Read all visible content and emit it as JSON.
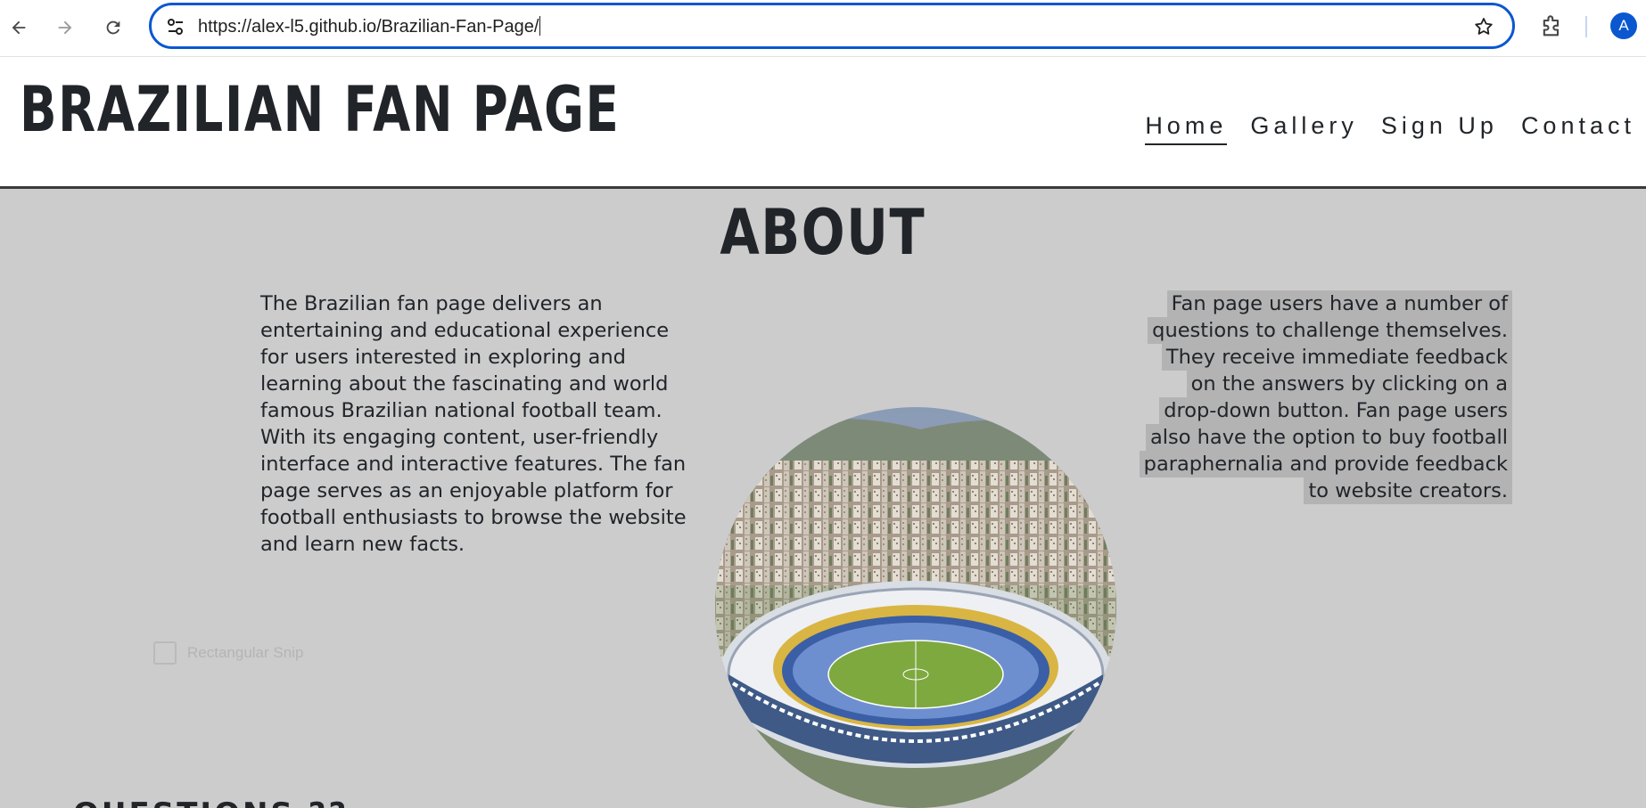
{
  "browser": {
    "url": "https://alex-l5.github.io/Brazilian-Fan-Page/",
    "avatar_letter": "A",
    "accent_color": "#0b57d0"
  },
  "header": {
    "title": "BRAZILIAN FAN PAGE",
    "nav": [
      {
        "label": "Home",
        "active": true
      },
      {
        "label": "Gallery",
        "active": false
      },
      {
        "label": "Sign Up",
        "active": false
      },
      {
        "label": "Contact",
        "active": false
      }
    ]
  },
  "about": {
    "heading": "ABOUT",
    "left_text": "The Brazilian fan page delivers an entertaining and educational experience for users interested in exploring and learning about the fascinating and world famous Brazilian national football team. With its engaging content, user-friendly interface and interactive features. The fan page serves as an enjoyable platform for football enthusiasts to browse the website and learn new facts.",
    "right_text": "Fan page users have a number of questions to challenge themselves. They receive immediate feedback on the answers by clicking on a drop-down button. Fan page users also have the option to buy football paraphernalia and provide feedback to website creators.",
    "image_icon": "stadium-image"
  },
  "overlay": {
    "snip_label": "Rectangular Snip"
  },
  "questions": {
    "heading": "QUESTIONS ??"
  },
  "colors": {
    "content_bg": "#cccccc",
    "text": "#212529",
    "highlight": "#b3b3b3"
  }
}
